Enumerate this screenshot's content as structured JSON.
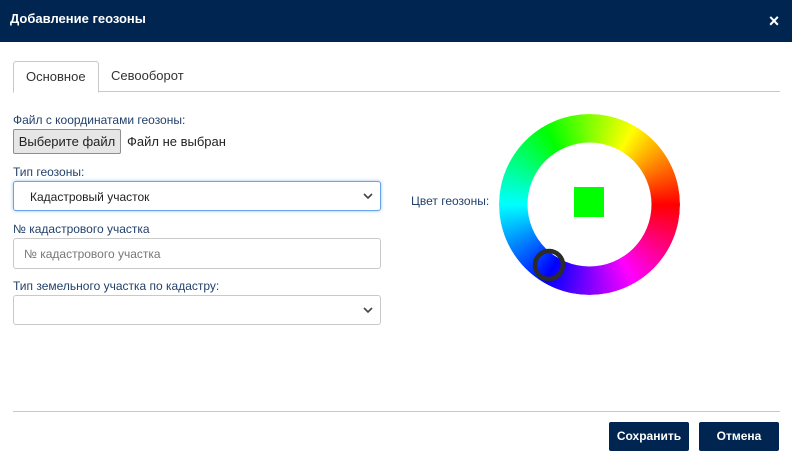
{
  "dialog": {
    "title": "Добавление геозоны",
    "close_symbol": "×"
  },
  "tabs": [
    {
      "label": "Основное",
      "active": true
    },
    {
      "label": "Севооборот",
      "active": false
    }
  ],
  "form": {
    "file": {
      "label": "Файл с координатами геозоны:",
      "button_label": "Выберите файл",
      "status": "Файл не выбран"
    },
    "geozone_type": {
      "label": "Тип геозоны:",
      "value": "Кадастровый участок",
      "icon": "chevron-down-icon"
    },
    "cadastral_number": {
      "label": "№ кадастрового участка",
      "value": "",
      "placeholder": "№ кадастрового участка"
    },
    "land_type": {
      "label": "Тип земельного участка по кадастру:",
      "value": "",
      "icon": "chevron-down-icon"
    },
    "color": {
      "label": "Цвет геозоны:",
      "selected_hex": "#00ff00"
    }
  },
  "footer": {
    "save_label": "Сохранить",
    "cancel_label": "Отмена"
  },
  "colors": {
    "header_bg": "#002550",
    "button_bg": "#002550",
    "label_text": "#23416b"
  }
}
